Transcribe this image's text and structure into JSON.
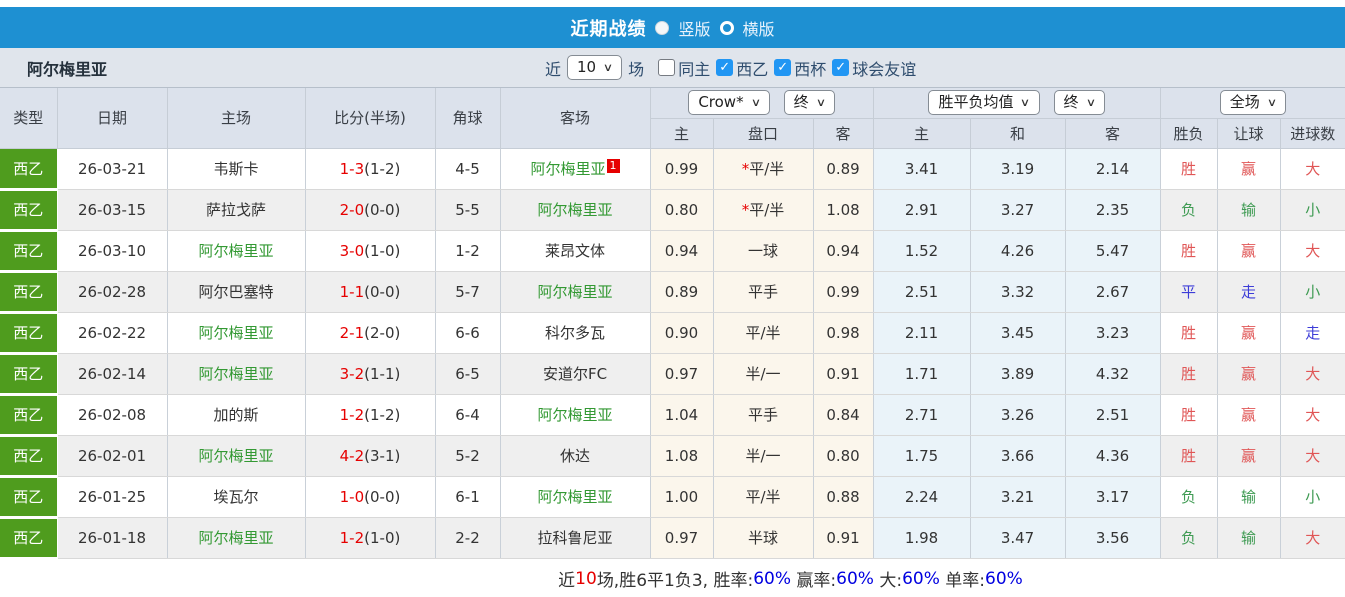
{
  "topbar": {
    "title": "近期战绩",
    "radio_vertical_label": "竖版",
    "radio_horizontal_label": "横版",
    "selected_layout": "竖版",
    "bar_color": "#1e90d2"
  },
  "filterbar": {
    "team": "阿尔梅里亚",
    "near_label": "近",
    "count_value": "10",
    "games_label": "场",
    "checkboxes": [
      {
        "label": "同主",
        "checked": false
      },
      {
        "label": "西乙",
        "checked": true
      },
      {
        "label": "西杯",
        "checked": true
      },
      {
        "label": "球会友谊",
        "checked": true
      }
    ]
  },
  "table": {
    "left_headers": [
      "类型",
      "日期",
      "主场",
      "比分(半场)",
      "角球",
      "客场"
    ],
    "odds_book_dropdown": "Crow*",
    "odds_state_dropdown": "终",
    "mean_dropdown": "胜平负均值",
    "mean_state_dropdown": "终",
    "fulltime_dropdown": "全场",
    "sub_headers": [
      "主",
      "盘口",
      "客",
      "主",
      "和",
      "客",
      "胜负",
      "让球",
      "进球数"
    ],
    "accent_colors": {
      "win": "#e05656",
      "lose": "#3f9b53",
      "draw": "#3d3dd8",
      "team_highlight": "#339933",
      "league": "#4f9c1e"
    },
    "rows": [
      {
        "type": "西乙",
        "date": "26-03-21",
        "home": {
          "text": "韦斯卡",
          "highlight": false
        },
        "score": {
          "main": "1-3",
          "half": "(1-2)"
        },
        "corners": "4-5",
        "away": {
          "text": "阿尔梅里亚",
          "highlight": true,
          "badge": "1"
        },
        "odds": {
          "home": "0.99",
          "away": "0.89"
        },
        "handicap": {
          "star": "*",
          "text": "平/半"
        },
        "mean": [
          "3.41",
          "3.19",
          "2.14"
        ],
        "result": [
          {
            "t": "胜",
            "c": "win"
          },
          {
            "t": "赢",
            "c": "win"
          },
          {
            "t": "大",
            "c": "win"
          }
        ]
      },
      {
        "type": "西乙",
        "date": "26-03-15",
        "home": {
          "text": "萨拉戈萨",
          "highlight": false
        },
        "score": {
          "main": "2-0",
          "half": "(0-0)"
        },
        "corners": "5-5",
        "away": {
          "text": "阿尔梅里亚",
          "highlight": true,
          "badge": ""
        },
        "odds": {
          "home": "0.80",
          "away": "1.08"
        },
        "handicap": {
          "star": "*",
          "text": "平/半"
        },
        "mean": [
          "2.91",
          "3.27",
          "2.35"
        ],
        "result": [
          {
            "t": "负",
            "c": "lose"
          },
          {
            "t": "输",
            "c": "lose"
          },
          {
            "t": "小",
            "c": "lose"
          }
        ]
      },
      {
        "type": "西乙",
        "date": "26-03-10",
        "home": {
          "text": "阿尔梅里亚",
          "highlight": true
        },
        "score": {
          "main": "3-0",
          "half": "(1-0)"
        },
        "corners": "1-2",
        "away": {
          "text": "莱昂文体",
          "highlight": false,
          "badge": ""
        },
        "odds": {
          "home": "0.94",
          "away": "0.94"
        },
        "handicap": {
          "star": "",
          "text": "一球"
        },
        "mean": [
          "1.52",
          "4.26",
          "5.47"
        ],
        "result": [
          {
            "t": "胜",
            "c": "win"
          },
          {
            "t": "赢",
            "c": "win"
          },
          {
            "t": "大",
            "c": "win"
          }
        ]
      },
      {
        "type": "西乙",
        "date": "26-02-28",
        "home": {
          "text": "阿尔巴塞特",
          "highlight": false
        },
        "score": {
          "main": "1-1",
          "half": "(0-0)"
        },
        "corners": "5-7",
        "away": {
          "text": "阿尔梅里亚",
          "highlight": true,
          "badge": ""
        },
        "odds": {
          "home": "0.89",
          "away": "0.99"
        },
        "handicap": {
          "star": "",
          "text": "平手"
        },
        "mean": [
          "2.51",
          "3.32",
          "2.67"
        ],
        "result": [
          {
            "t": "平",
            "c": "draw"
          },
          {
            "t": "走",
            "c": "draw"
          },
          {
            "t": "小",
            "c": "lose"
          }
        ]
      },
      {
        "type": "西乙",
        "date": "26-02-22",
        "home": {
          "text": "阿尔梅里亚",
          "highlight": true
        },
        "score": {
          "main": "2-1",
          "half": "(2-0)"
        },
        "corners": "6-6",
        "away": {
          "text": "科尔多瓦",
          "highlight": false,
          "badge": ""
        },
        "odds": {
          "home": "0.90",
          "away": "0.98"
        },
        "handicap": {
          "star": "",
          "text": "平/半"
        },
        "mean": [
          "2.11",
          "3.45",
          "3.23"
        ],
        "result": [
          {
            "t": "胜",
            "c": "win"
          },
          {
            "t": "赢",
            "c": "win"
          },
          {
            "t": "走",
            "c": "draw"
          }
        ]
      },
      {
        "type": "西乙",
        "date": "26-02-14",
        "home": {
          "text": "阿尔梅里亚",
          "highlight": true
        },
        "score": {
          "main": "3-2",
          "half": "(1-1)"
        },
        "corners": "6-5",
        "away": {
          "text": "安道尔FC",
          "highlight": false,
          "badge": ""
        },
        "odds": {
          "home": "0.97",
          "away": "0.91"
        },
        "handicap": {
          "star": "",
          "text": "半/一"
        },
        "mean": [
          "1.71",
          "3.89",
          "4.32"
        ],
        "result": [
          {
            "t": "胜",
            "c": "win"
          },
          {
            "t": "赢",
            "c": "win"
          },
          {
            "t": "大",
            "c": "win"
          }
        ]
      },
      {
        "type": "西乙",
        "date": "26-02-08",
        "home": {
          "text": "加的斯",
          "highlight": false
        },
        "score": {
          "main": "1-2",
          "half": "(1-2)"
        },
        "corners": "6-4",
        "away": {
          "text": "阿尔梅里亚",
          "highlight": true,
          "badge": ""
        },
        "odds": {
          "home": "1.04",
          "away": "0.84"
        },
        "handicap": {
          "star": "",
          "text": "平手"
        },
        "mean": [
          "2.71",
          "3.26",
          "2.51"
        ],
        "result": [
          {
            "t": "胜",
            "c": "win"
          },
          {
            "t": "赢",
            "c": "win"
          },
          {
            "t": "大",
            "c": "win"
          }
        ]
      },
      {
        "type": "西乙",
        "date": "26-02-01",
        "home": {
          "text": "阿尔梅里亚",
          "highlight": true
        },
        "score": {
          "main": "4-2",
          "half": "(3-1)"
        },
        "corners": "5-2",
        "away": {
          "text": "休达",
          "highlight": false,
          "badge": ""
        },
        "odds": {
          "home": "1.08",
          "away": "0.80"
        },
        "handicap": {
          "star": "",
          "text": "半/一"
        },
        "mean": [
          "1.75",
          "3.66",
          "4.36"
        ],
        "result": [
          {
            "t": "胜",
            "c": "win"
          },
          {
            "t": "赢",
            "c": "win"
          },
          {
            "t": "大",
            "c": "win"
          }
        ]
      },
      {
        "type": "西乙",
        "date": "26-01-25",
        "home": {
          "text": "埃瓦尔",
          "highlight": false
        },
        "score": {
          "main": "1-0",
          "half": "(0-0)"
        },
        "corners": "6-1",
        "away": {
          "text": "阿尔梅里亚",
          "highlight": true,
          "badge": ""
        },
        "odds": {
          "home": "1.00",
          "away": "0.88"
        },
        "handicap": {
          "star": "",
          "text": "平/半"
        },
        "mean": [
          "2.24",
          "3.21",
          "3.17"
        ],
        "result": [
          {
            "t": "负",
            "c": "lose"
          },
          {
            "t": "输",
            "c": "lose"
          },
          {
            "t": "小",
            "c": "lose"
          }
        ]
      },
      {
        "type": "西乙",
        "date": "26-01-18",
        "home": {
          "text": "阿尔梅里亚",
          "highlight": true
        },
        "score": {
          "main": "1-2",
          "half": "(1-0)"
        },
        "corners": "2-2",
        "away": {
          "text": "拉科鲁尼亚",
          "highlight": false,
          "badge": ""
        },
        "odds": {
          "home": "0.97",
          "away": "0.91"
        },
        "handicap": {
          "star": "",
          "text": "半球"
        },
        "mean": [
          "1.98",
          "3.47",
          "3.56"
        ],
        "result": [
          {
            "t": "负",
            "c": "lose"
          },
          {
            "t": "输",
            "c": "lose"
          },
          {
            "t": "大",
            "c": "win"
          }
        ]
      }
    ]
  },
  "footer": {
    "segments": [
      {
        "t": "近",
        "c": "dark"
      },
      {
        "t": "10",
        "c": "red"
      },
      {
        "t": "场,胜6平1负3, 胜率:",
        "c": "dark"
      },
      {
        "t": "60%",
        "c": "blue"
      },
      {
        "t": " 赢率:",
        "c": "dark"
      },
      {
        "t": "60%",
        "c": "blue"
      },
      {
        "t": " 大:",
        "c": "dark"
      },
      {
        "t": "60%",
        "c": "blue"
      },
      {
        "t": " 单率:",
        "c": "dark"
      },
      {
        "t": "60%",
        "c": "blue"
      }
    ]
  }
}
